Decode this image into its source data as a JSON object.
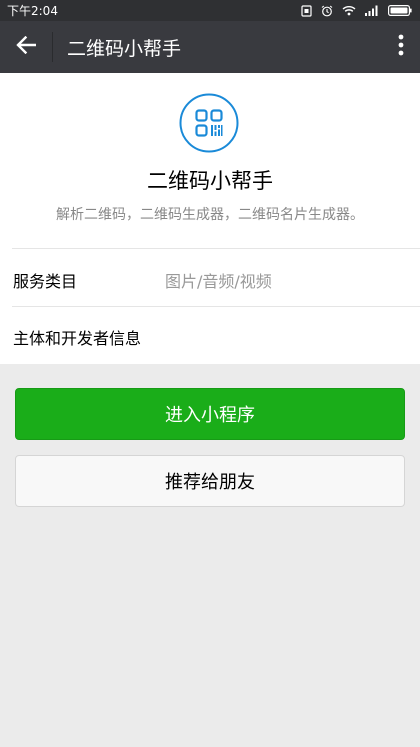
{
  "status_bar": {
    "time": "下午2:04",
    "icons": [
      "sim-icon",
      "alarm-icon",
      "wifi-icon",
      "signal-icon",
      "battery-icon"
    ]
  },
  "title_bar": {
    "title": "二维码小帮手",
    "back_icon": "arrow-left-icon",
    "more_icon": "more-vertical-icon"
  },
  "app": {
    "logo_icon": "qr-code-icon",
    "name": "二维码小帮手",
    "description": "解析二维码，二维码生成器，二维码名片生成器。"
  },
  "details": {
    "category_label": "服务类目",
    "category_value": "图片/音频/视频",
    "developer_label": "主体和开发者信息"
  },
  "actions": {
    "enter_label": "进入小程序",
    "share_label": "推荐给朋友"
  },
  "colors": {
    "primary_green": "#1aad19",
    "logo_blue": "#1a8ad8",
    "title_bar": "#393a3f",
    "status_bar": "#2f3033"
  }
}
